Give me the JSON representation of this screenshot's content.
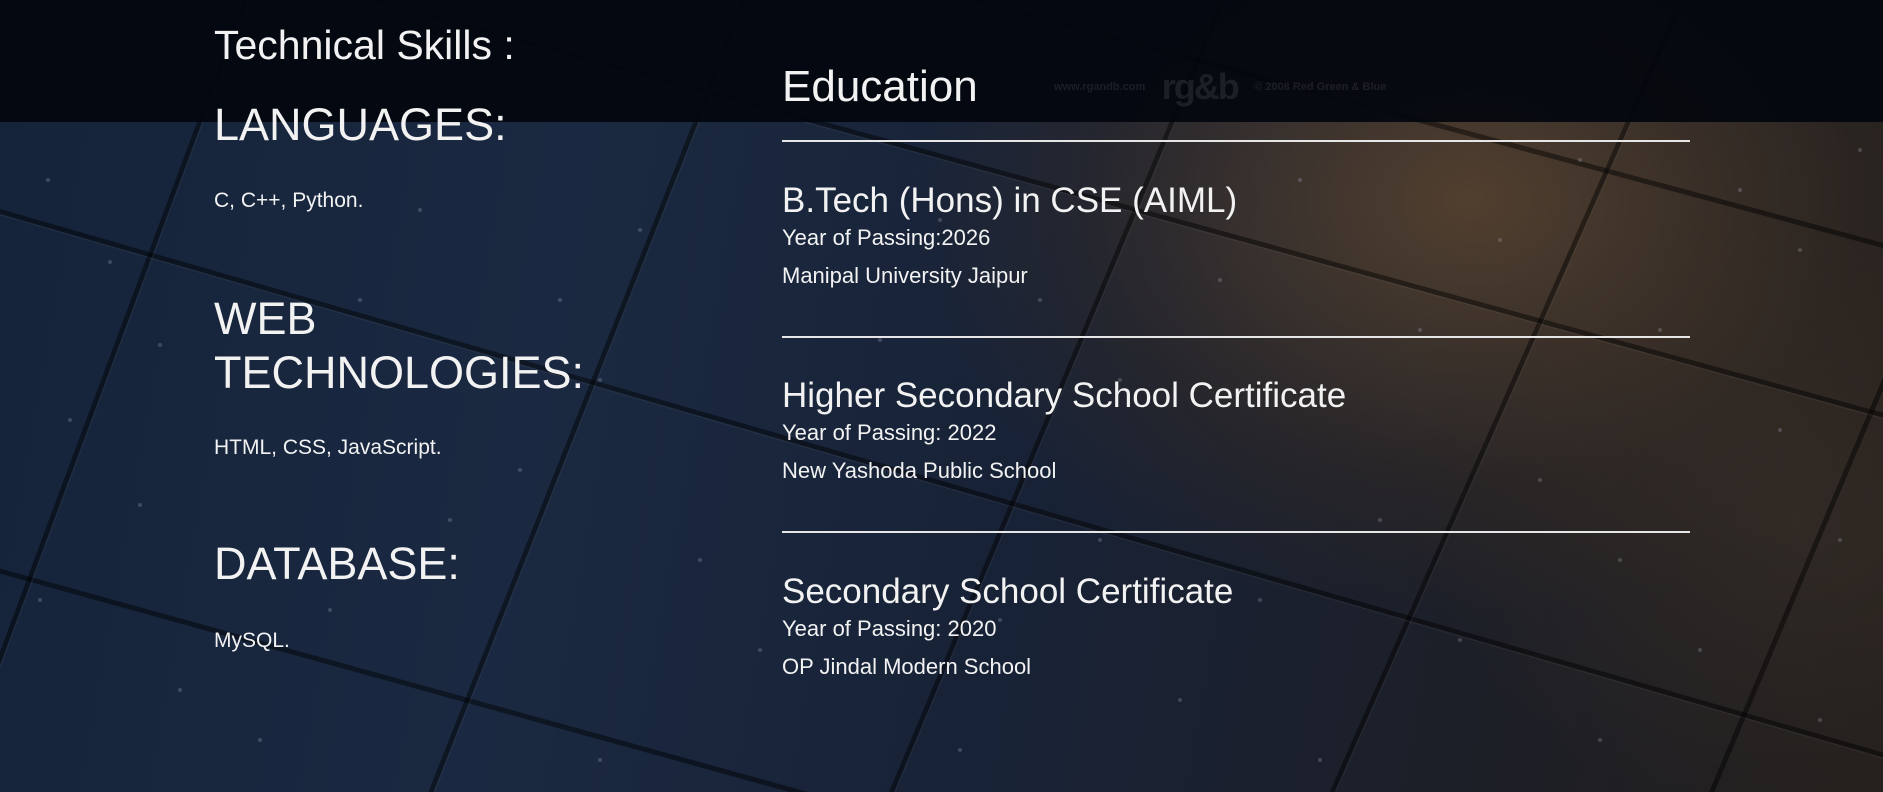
{
  "skills": {
    "title": "Technical Skills :",
    "categories": [
      {
        "heading": "LANGUAGES:",
        "items": "C, C++, Python."
      },
      {
        "heading": "WEB TECHNOLOGIES:",
        "items": "HTML, CSS, JavaScript."
      },
      {
        "heading": "DATABASE:",
        "items": "MySQL."
      }
    ]
  },
  "education": {
    "title": "Education",
    "entries": [
      {
        "degree": "B.Tech (Hons) in CSE (AIML)",
        "year": "Year of Passing:2026",
        "school": "Manipal University Jaipur"
      },
      {
        "degree": "Higher Secondary School Certificate",
        "year": "Year of Passing: 2022",
        "school": "New Yashoda Public School"
      },
      {
        "degree": "Secondary School Certificate",
        "year": "Year of Passing: 2020",
        "school": "OP Jindal Modern School"
      }
    ]
  },
  "watermark": {
    "url": "www.rgandb.com",
    "logo": "rg&b",
    "copyright": "© 2008 Red Green & Blue"
  },
  "colors": {
    "text": "#f2f2f2",
    "divider": "#e6e6e6",
    "topbar": "#03060e"
  }
}
